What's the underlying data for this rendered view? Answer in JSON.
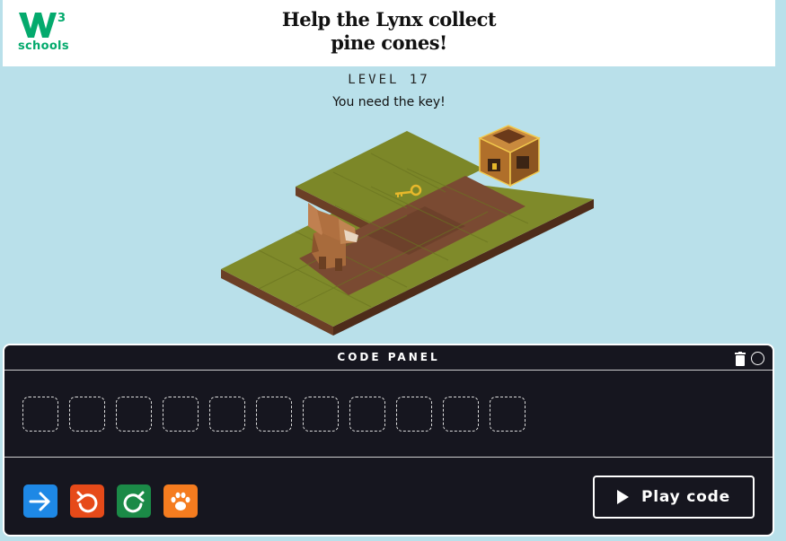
{
  "header": {
    "logo_text": "schools",
    "logo_sup": "3",
    "title_line1": "Help the Lynx collect",
    "title_line2": "pine cones!"
  },
  "game": {
    "level": "LEVEL 17",
    "message": "You need the key!"
  },
  "code_panel": {
    "title": "CODE PANEL",
    "slot_count": 11,
    "commands": [
      {
        "name": "move-forward",
        "color": "#1e88e5"
      },
      {
        "name": "turn-left",
        "color": "#e64a19"
      },
      {
        "name": "turn-right",
        "color": "#1b8a47"
      },
      {
        "name": "paw-action",
        "color": "#f57c1f"
      }
    ],
    "play_label": "Play code"
  },
  "colors": {
    "background": "#b9e0ea",
    "panel": "#16161f",
    "brand": "#04aa6d"
  }
}
